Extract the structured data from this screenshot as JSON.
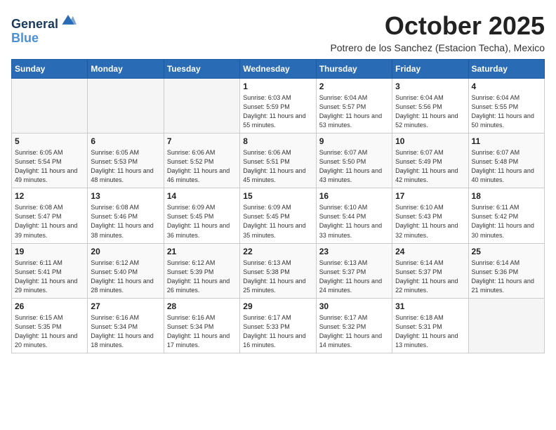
{
  "header": {
    "logo_line1": "General",
    "logo_line2": "Blue",
    "month": "October 2025",
    "location": "Potrero de los Sanchez (Estacion Techa), Mexico"
  },
  "days_of_week": [
    "Sunday",
    "Monday",
    "Tuesday",
    "Wednesday",
    "Thursday",
    "Friday",
    "Saturday"
  ],
  "weeks": [
    [
      {
        "day": "",
        "empty": true
      },
      {
        "day": "",
        "empty": true
      },
      {
        "day": "",
        "empty": true
      },
      {
        "day": "1",
        "sunrise": "6:03 AM",
        "sunset": "5:59 PM",
        "daylight": "11 hours and 55 minutes."
      },
      {
        "day": "2",
        "sunrise": "6:04 AM",
        "sunset": "5:57 PM",
        "daylight": "11 hours and 53 minutes."
      },
      {
        "day": "3",
        "sunrise": "6:04 AM",
        "sunset": "5:56 PM",
        "daylight": "11 hours and 52 minutes."
      },
      {
        "day": "4",
        "sunrise": "6:04 AM",
        "sunset": "5:55 PM",
        "daylight": "11 hours and 50 minutes."
      }
    ],
    [
      {
        "day": "5",
        "sunrise": "6:05 AM",
        "sunset": "5:54 PM",
        "daylight": "11 hours and 49 minutes."
      },
      {
        "day": "6",
        "sunrise": "6:05 AM",
        "sunset": "5:53 PM",
        "daylight": "11 hours and 48 minutes."
      },
      {
        "day": "7",
        "sunrise": "6:06 AM",
        "sunset": "5:52 PM",
        "daylight": "11 hours and 46 minutes."
      },
      {
        "day": "8",
        "sunrise": "6:06 AM",
        "sunset": "5:51 PM",
        "daylight": "11 hours and 45 minutes."
      },
      {
        "day": "9",
        "sunrise": "6:07 AM",
        "sunset": "5:50 PM",
        "daylight": "11 hours and 43 minutes."
      },
      {
        "day": "10",
        "sunrise": "6:07 AM",
        "sunset": "5:49 PM",
        "daylight": "11 hours and 42 minutes."
      },
      {
        "day": "11",
        "sunrise": "6:07 AM",
        "sunset": "5:48 PM",
        "daylight": "11 hours and 40 minutes."
      }
    ],
    [
      {
        "day": "12",
        "sunrise": "6:08 AM",
        "sunset": "5:47 PM",
        "daylight": "11 hours and 39 minutes."
      },
      {
        "day": "13",
        "sunrise": "6:08 AM",
        "sunset": "5:46 PM",
        "daylight": "11 hours and 38 minutes."
      },
      {
        "day": "14",
        "sunrise": "6:09 AM",
        "sunset": "5:45 PM",
        "daylight": "11 hours and 36 minutes."
      },
      {
        "day": "15",
        "sunrise": "6:09 AM",
        "sunset": "5:45 PM",
        "daylight": "11 hours and 35 minutes."
      },
      {
        "day": "16",
        "sunrise": "6:10 AM",
        "sunset": "5:44 PM",
        "daylight": "11 hours and 33 minutes."
      },
      {
        "day": "17",
        "sunrise": "6:10 AM",
        "sunset": "5:43 PM",
        "daylight": "11 hours and 32 minutes."
      },
      {
        "day": "18",
        "sunrise": "6:11 AM",
        "sunset": "5:42 PM",
        "daylight": "11 hours and 30 minutes."
      }
    ],
    [
      {
        "day": "19",
        "sunrise": "6:11 AM",
        "sunset": "5:41 PM",
        "daylight": "11 hours and 29 minutes."
      },
      {
        "day": "20",
        "sunrise": "6:12 AM",
        "sunset": "5:40 PM",
        "daylight": "11 hours and 28 minutes."
      },
      {
        "day": "21",
        "sunrise": "6:12 AM",
        "sunset": "5:39 PM",
        "daylight": "11 hours and 26 minutes."
      },
      {
        "day": "22",
        "sunrise": "6:13 AM",
        "sunset": "5:38 PM",
        "daylight": "11 hours and 25 minutes."
      },
      {
        "day": "23",
        "sunrise": "6:13 AM",
        "sunset": "5:37 PM",
        "daylight": "11 hours and 24 minutes."
      },
      {
        "day": "24",
        "sunrise": "6:14 AM",
        "sunset": "5:37 PM",
        "daylight": "11 hours and 22 minutes."
      },
      {
        "day": "25",
        "sunrise": "6:14 AM",
        "sunset": "5:36 PM",
        "daylight": "11 hours and 21 minutes."
      }
    ],
    [
      {
        "day": "26",
        "sunrise": "6:15 AM",
        "sunset": "5:35 PM",
        "daylight": "11 hours and 20 minutes."
      },
      {
        "day": "27",
        "sunrise": "6:16 AM",
        "sunset": "5:34 PM",
        "daylight": "11 hours and 18 minutes."
      },
      {
        "day": "28",
        "sunrise": "6:16 AM",
        "sunset": "5:34 PM",
        "daylight": "11 hours and 17 minutes."
      },
      {
        "day": "29",
        "sunrise": "6:17 AM",
        "sunset": "5:33 PM",
        "daylight": "11 hours and 16 minutes."
      },
      {
        "day": "30",
        "sunrise": "6:17 AM",
        "sunset": "5:32 PM",
        "daylight": "11 hours and 14 minutes."
      },
      {
        "day": "31",
        "sunrise": "6:18 AM",
        "sunset": "5:31 PM",
        "daylight": "11 hours and 13 minutes."
      },
      {
        "day": "",
        "empty": true
      }
    ]
  ]
}
